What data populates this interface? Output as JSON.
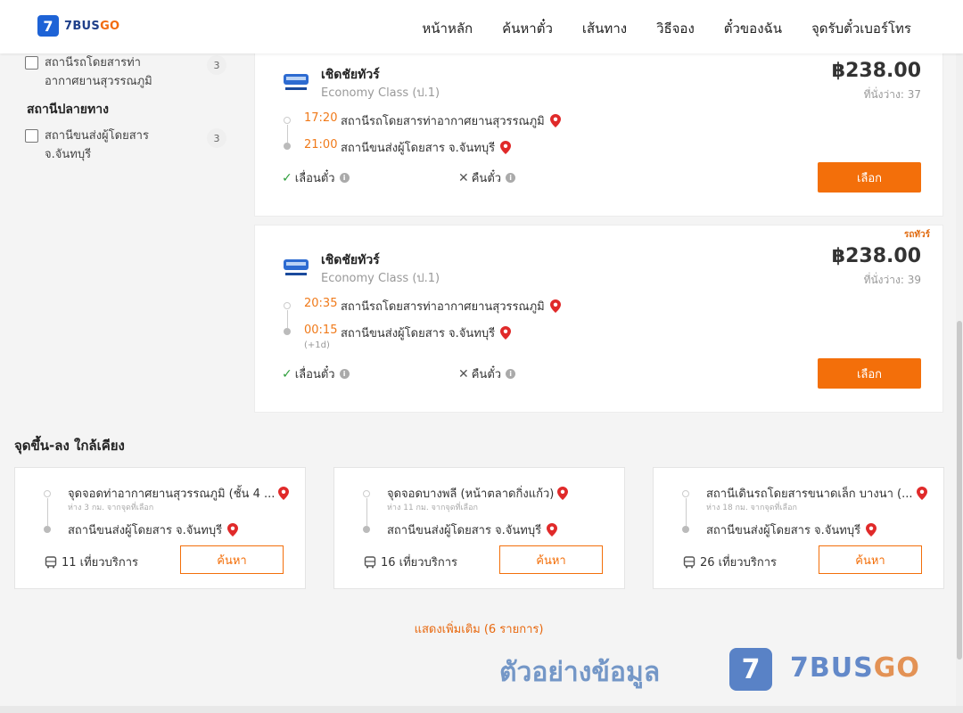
{
  "header": {
    "logo_text": "7BUS",
    "logo_text_go": "GO",
    "logo_num": "7",
    "nav": [
      "หน้าหลัก",
      "ค้นหาตั๋ว",
      "เส้นทาง",
      "วิธีจอง",
      "ตั๋วของฉัน",
      "จุดรับตั๋วเบอร์โทร"
    ]
  },
  "sidebar": {
    "origin_item": {
      "label": "สถานีรถโดยสารท่าอากาศยานสุวรรณภูมิ",
      "count": "3"
    },
    "destination_heading": "สถานีปลายทาง",
    "destination_item": {
      "label": "สถานีขนส่งผู้โดยสาร จ.จันทบุรี",
      "count": "3"
    }
  },
  "trips": [
    {
      "operator": "เชิดชัยทัวร์",
      "class": "Economy Class (ป.1)",
      "price": "฿238.00",
      "seats": "ที่นั่งว่าง: 37",
      "tag": "",
      "depart_time": "17:20",
      "depart_station": "สถานีรถโดยสารท่าอากาศยานสุวรรณภูมิ",
      "arrive_time": "21:00",
      "arrive_station": "สถานีขนส่งผู้โดยสาร จ.จันทบุรี",
      "plus_day": "",
      "reschedule": "เลื่อนตั๋ว",
      "refund": "คืนตั๋ว",
      "button": "เลือก"
    },
    {
      "operator": "เชิดชัยทัวร์",
      "class": "Economy Class (ป.1)",
      "price": "฿238.00",
      "seats": "ที่นั่งว่าง: 39",
      "tag": "รถทัวร์",
      "depart_time": "20:35",
      "depart_station": "สถานีรถโดยสารท่าอากาศยานสุวรรณภูมิ",
      "arrive_time": "00:15",
      "arrive_station": "สถานีขนส่งผู้โดยสาร จ.จันทบุรี",
      "plus_day": "(+1d)",
      "reschedule": "เลื่อนตั๋ว",
      "refund": "คืนตั๋ว",
      "button": "เลือก"
    }
  ],
  "nearby": {
    "heading": "จุดขึ้น-ลง ใกล้เคียง",
    "items": [
      {
        "from": "จุดจอดท่าอากาศยานสุวรรณภูมิ (ชั้น 4 ...",
        "distance": "ห่าง 3 กม. จากจุดที่เลือก",
        "to": "สถานีขนส่งผู้โดยสาร จ.จันทบุรี",
        "trips": "11 เที่ยวบริการ",
        "button": "ค้นหา"
      },
      {
        "from": "จุดจอดบางพลี (หน้าตลาดกิ่งแก้ว)",
        "distance": "ห่าง 11 กม. จากจุดที่เลือก",
        "to": "สถานีขนส่งผู้โดยสาร จ.จันทบุรี",
        "trips": "16 เที่ยวบริการ",
        "button": "ค้นหา"
      },
      {
        "from": "สถานีเดินรถโดยสารขนาดเล็ก บางนา (...",
        "distance": "ห่าง 18 กม. จากจุดที่เลือก",
        "to": "สถานีขนส่งผู้โดยสาร จ.จันทบุรี",
        "trips": "26 เที่ยวบริการ",
        "button": "ค้นหา"
      }
    ]
  },
  "show_more": "แสดงเพิ่มเติม (6 รายการ)",
  "watermark": {
    "text": "ตัวอย่างข้อมูล",
    "brand": "7BUS",
    "brand_go": "GO",
    "logo_num": "7"
  },
  "colors": {
    "accent": "#f36f0a",
    "brand_blue": "#1e63d6",
    "pin": "#e02a2a",
    "check": "#2e9e3c"
  }
}
